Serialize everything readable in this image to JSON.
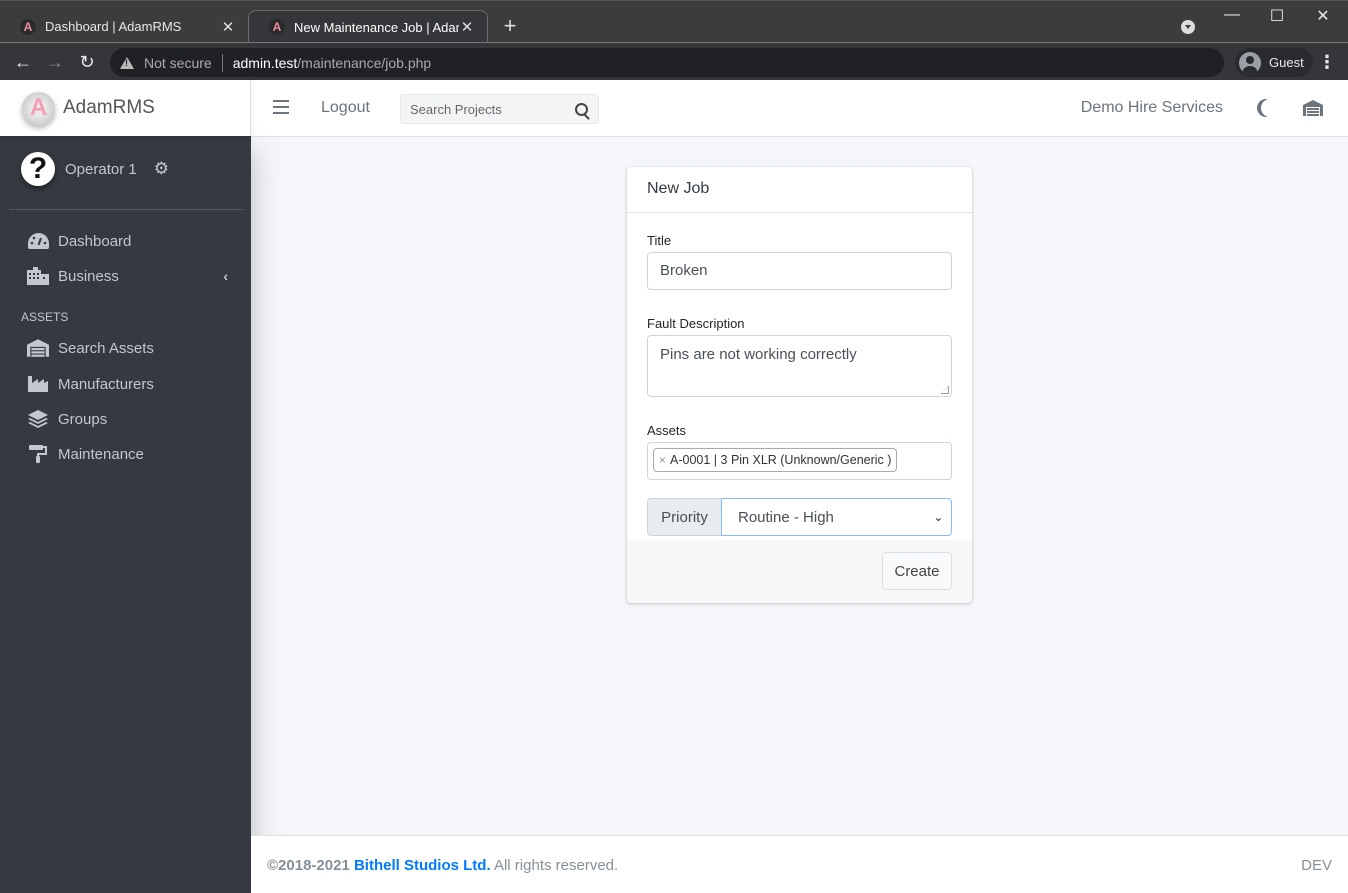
{
  "browser": {
    "tabs": [
      {
        "title": "Dashboard | AdamRMS",
        "favicon": "A",
        "active": false
      },
      {
        "title": "New Maintenance Job | AdamRMS",
        "favicon": "A",
        "active": true
      }
    ],
    "new_tab_label": "+",
    "security_label": "Not secure",
    "url_host": "admin.test",
    "url_path": "/maintenance/job.php",
    "profile_label": "Guest",
    "icons": {
      "back": "←",
      "forward": "→",
      "reload": "↻",
      "close": "✕",
      "minimize": "—",
      "maximize": "☐",
      "menu": "⋮"
    }
  },
  "app": {
    "brand": "AdamRMS",
    "logo_letter": "A",
    "topnav": {
      "logout_label": "Logout",
      "search_placeholder": "Search Projects",
      "organisation": "Demo Hire Services"
    },
    "sidebar": {
      "user_name": "Operator 1",
      "avatar_glyph": "?",
      "gear_glyph": "⚙",
      "items": [
        {
          "label": "Dashboard",
          "icon": "tachometer-icon"
        },
        {
          "label": "Business",
          "icon": "building-icon",
          "chevron": "‹"
        }
      ],
      "section_header": "ASSETS",
      "asset_items": [
        {
          "label": "Search Assets",
          "icon": "warehouse-icon"
        },
        {
          "label": "Manufacturers",
          "icon": "industry-icon"
        },
        {
          "label": "Groups",
          "icon": "layer-group-icon"
        },
        {
          "label": "Maintenance",
          "icon": "paint-roller-icon"
        }
      ]
    },
    "card": {
      "header": "New Job",
      "title_label": "Title",
      "title_value": "Broken",
      "desc_label": "Fault Description",
      "desc_value": "Pins are not working correctly",
      "assets_label": "Assets",
      "asset_chips": [
        {
          "label": "A-0001 | 3 Pin XLR (Unknown/Generic )",
          "remove": "×"
        }
      ],
      "priority_label": "Priority",
      "priority_value": "Routine - High",
      "create_label": "Create"
    },
    "footer": {
      "copyright": "©2018-2021",
      "company": "Bithell Studios Ltd.",
      "rights": "All rights reserved.",
      "version": "DEV"
    }
  },
  "colors": {
    "sidebar_bg": "#343a40",
    "link_blue": "#007bff",
    "content_bg": "#f4f6f9",
    "focus_border": "#80bdff"
  }
}
